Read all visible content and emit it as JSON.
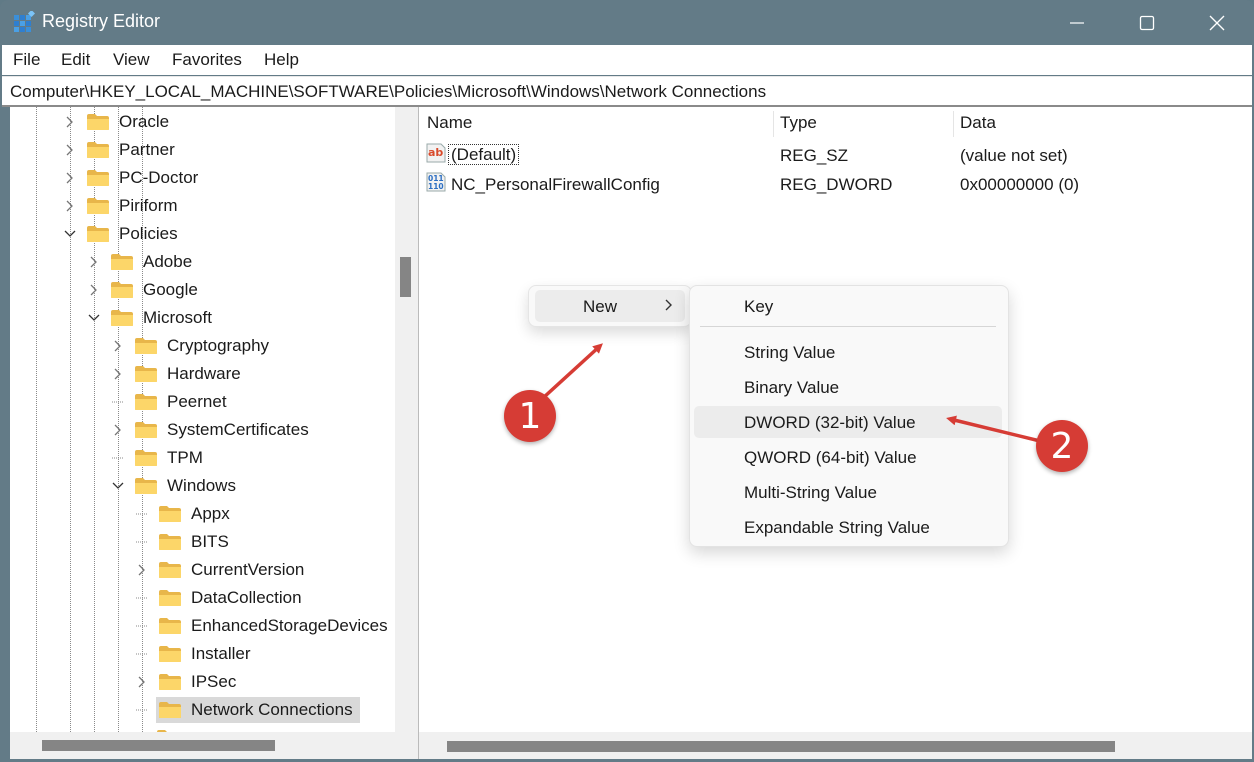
{
  "window": {
    "title": "Registry Editor",
    "controls": {
      "minimize": "minimize",
      "maximize": "maximize",
      "close": "close"
    }
  },
  "menubar": [
    "File",
    "Edit",
    "View",
    "Favorites",
    "Help"
  ],
  "address": "Computer\\HKEY_LOCAL_MACHINE\\SOFTWARE\\Policies\\Microsoft\\Windows\\Network Connections",
  "tree": {
    "items": [
      {
        "label": "Oracle",
        "level": 0,
        "expander": "collapsed"
      },
      {
        "label": "Partner",
        "level": 0,
        "expander": "collapsed"
      },
      {
        "label": "PC-Doctor",
        "level": 0,
        "expander": "collapsed"
      },
      {
        "label": "Piriform",
        "level": 0,
        "expander": "collapsed"
      },
      {
        "label": "Policies",
        "level": 0,
        "expander": "expanded"
      },
      {
        "label": "Adobe",
        "level": 1,
        "expander": "collapsed"
      },
      {
        "label": "Google",
        "level": 1,
        "expander": "collapsed"
      },
      {
        "label": "Microsoft",
        "level": 1,
        "expander": "expanded"
      },
      {
        "label": "Cryptography",
        "level": 2,
        "expander": "collapsed"
      },
      {
        "label": "Hardware",
        "level": 2,
        "expander": "collapsed"
      },
      {
        "label": "Peernet",
        "level": 2,
        "expander": "none"
      },
      {
        "label": "SystemCertificates",
        "level": 2,
        "expander": "collapsed"
      },
      {
        "label": "TPM",
        "level": 2,
        "expander": "none"
      },
      {
        "label": "Windows",
        "level": 2,
        "expander": "expanded"
      },
      {
        "label": "Appx",
        "level": 3,
        "expander": "none"
      },
      {
        "label": "BITS",
        "level": 3,
        "expander": "none"
      },
      {
        "label": "CurrentVersion",
        "level": 3,
        "expander": "collapsed"
      },
      {
        "label": "DataCollection",
        "level": 3,
        "expander": "none"
      },
      {
        "label": "EnhancedStorageDevices",
        "level": 3,
        "expander": "none"
      },
      {
        "label": "Installer",
        "level": 3,
        "expander": "none"
      },
      {
        "label": "IPSec",
        "level": 3,
        "expander": "collapsed"
      },
      {
        "label": "Network Connections",
        "level": 3,
        "expander": "none",
        "selected": true
      }
    ]
  },
  "list": {
    "columns": [
      "Name",
      "Type",
      "Data"
    ],
    "rows": [
      {
        "icon": "string-value-icon",
        "name": "(Default)",
        "type": "REG_SZ",
        "data": "(value not set)"
      },
      {
        "icon": "binary-value-icon",
        "name": "NC_PersonalFirewallConfig",
        "type": "REG_DWORD",
        "data": "0x00000000 (0)"
      }
    ]
  },
  "context_menu": {
    "new_label": "New",
    "submenu": [
      {
        "label": "Key"
      },
      {
        "label": "String Value"
      },
      {
        "label": "Binary Value"
      },
      {
        "label": "DWORD (32-bit) Value",
        "hover": true
      },
      {
        "label": "QWORD (64-bit) Value"
      },
      {
        "label": "Multi-String Value"
      },
      {
        "label": "Expandable String Value"
      }
    ]
  },
  "annotations": {
    "step1": "1",
    "step2": "2",
    "color": "#d63c35"
  }
}
